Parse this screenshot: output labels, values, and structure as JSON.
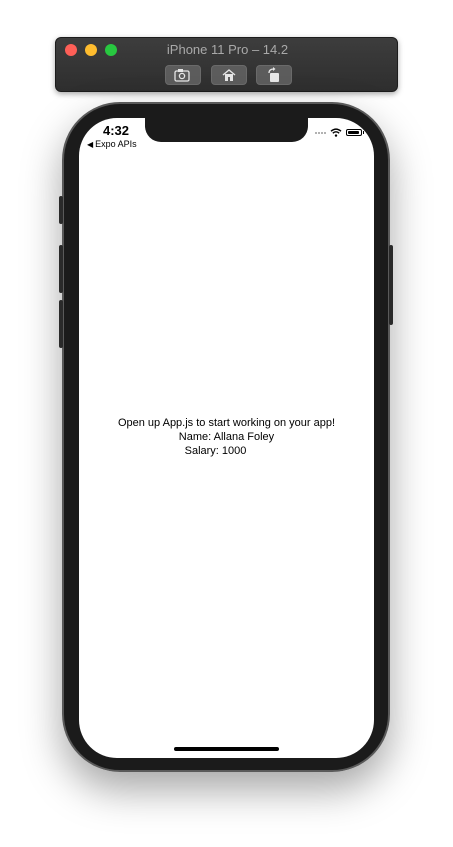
{
  "simulator": {
    "title": "iPhone 11 Pro – 14.2",
    "toolbar": [
      {
        "icon": "screenshot-icon"
      },
      {
        "icon": "home-icon"
      },
      {
        "icon": "rotate-icon"
      }
    ]
  },
  "status_bar": {
    "time": "4:32",
    "back_label": "Expo APIs"
  },
  "app": {
    "message": "Open up App.js to start working on your app!",
    "name_line": "Name: Allana Foley",
    "salary_line": "Salary: 1000"
  }
}
